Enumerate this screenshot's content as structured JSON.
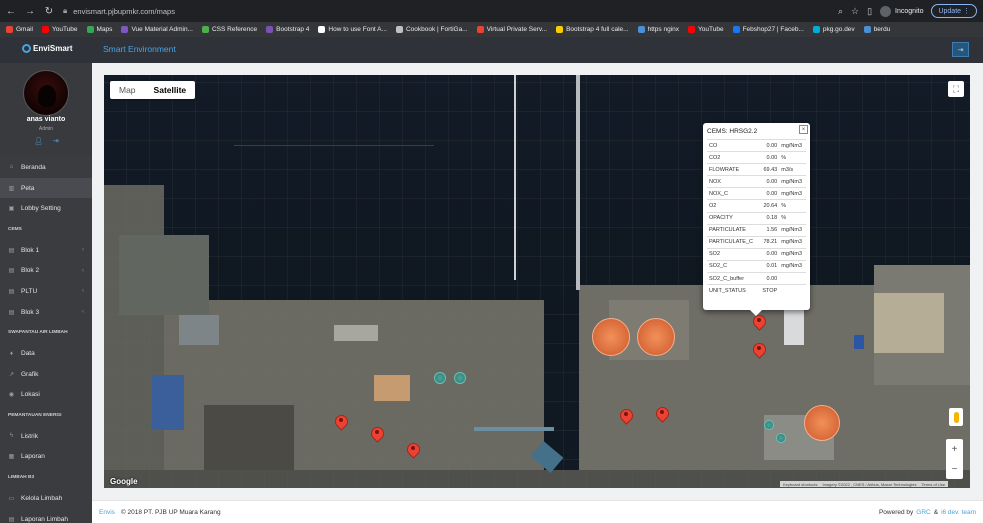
{
  "browser": {
    "url": "envismart.pjbupmkr.com/maps",
    "incognito_label": "Incognito",
    "update_label": "Update",
    "bookmarks": [
      {
        "label": "Gmail",
        "color": "#ea4335"
      },
      {
        "label": "YouTube",
        "color": "#ff0000"
      },
      {
        "label": "Maps",
        "color": "#34a853"
      },
      {
        "label": "Vue Material Admin...",
        "color": "#7e57c2"
      },
      {
        "label": "CSS Reference",
        "color": "#4caf50"
      },
      {
        "label": "Bootstrap 4",
        "color": "#7952b3"
      },
      {
        "label": "How to use Font A...",
        "color": "#ffffff"
      },
      {
        "label": "Cookbook | FortiGa...",
        "color": "#c0c0c0"
      },
      {
        "label": "Virtual Private Serv...",
        "color": "#ea4335"
      },
      {
        "label": "Bootstrap 4 full cale...",
        "color": "#ffcc00"
      },
      {
        "label": "https nginx",
        "color": "#4a90d9"
      },
      {
        "label": "YouTube",
        "color": "#ff0000"
      },
      {
        "label": "Febshop27 | Faceb...",
        "color": "#1877f2"
      },
      {
        "label": "pkg.go.dev",
        "color": "#00add8"
      },
      {
        "label": "berdu",
        "color": "#4a90d9"
      }
    ]
  },
  "app": {
    "logo_text": "EnviSmart",
    "title": "Smart Environment",
    "accent": "#4aa3df"
  },
  "user": {
    "name": "anas vianto",
    "role": "Admin"
  },
  "sidebar": {
    "items": [
      {
        "type": "item",
        "label": "Beranda",
        "icon": "home-icon",
        "glyph": "⌂",
        "arrow": ""
      },
      {
        "type": "item",
        "label": "Peta",
        "icon": "map-icon",
        "glyph": "▥",
        "arrow": "",
        "active": true
      },
      {
        "type": "item",
        "label": "Lobby Setting",
        "icon": "image-icon",
        "glyph": "▣",
        "arrow": ""
      },
      {
        "type": "section",
        "label": "CEMS"
      },
      {
        "type": "item",
        "label": "Blok 1",
        "icon": "file-icon",
        "glyph": "▤",
        "arrow": "‹"
      },
      {
        "type": "item",
        "label": "Blok 2",
        "icon": "file-icon",
        "glyph": "▤",
        "arrow": "‹"
      },
      {
        "type": "item",
        "label": "PLTU",
        "icon": "file-icon",
        "glyph": "▤",
        "arrow": "‹"
      },
      {
        "type": "item",
        "label": "Blok 3",
        "icon": "file-icon",
        "glyph": "▤",
        "arrow": "‹"
      },
      {
        "type": "section",
        "label": "SWAPANTAU AIR LIMBAH"
      },
      {
        "type": "item",
        "label": "Data",
        "icon": "droplet-icon",
        "glyph": "♦",
        "arrow": ""
      },
      {
        "type": "item",
        "label": "Grafik",
        "icon": "chart-icon",
        "glyph": "↗",
        "arrow": ""
      },
      {
        "type": "item",
        "label": "Lokasi",
        "icon": "location-icon",
        "glyph": "◉",
        "arrow": ""
      },
      {
        "type": "section",
        "label": "PEMANTAUAN ENERGI"
      },
      {
        "type": "item",
        "label": "Listrik",
        "icon": "bolt-icon",
        "glyph": "ϟ",
        "arrow": ""
      },
      {
        "type": "item",
        "label": "Laporan",
        "icon": "report-icon",
        "glyph": "▦",
        "arrow": ""
      },
      {
        "type": "section",
        "label": "LIMBAH B3"
      },
      {
        "type": "item",
        "label": "Kelola Limbah",
        "icon": "monitor-icon",
        "glyph": "▭",
        "arrow": ""
      },
      {
        "type": "item",
        "label": "Laporan Limbah",
        "icon": "report-icon",
        "glyph": "▤",
        "arrow": ""
      }
    ]
  },
  "map": {
    "type_map": "Map",
    "type_satellite": "Satellite",
    "selected_type": "Satellite",
    "google_label": "Google",
    "attribution": [
      "Keyboard shortcuts",
      "Imagery ©2022 , CNES / Airbus, Maxar Technologies",
      "Terms of Use"
    ]
  },
  "infowindow": {
    "title": "CEMS: HRSG2.2",
    "rows": [
      {
        "param": "CO",
        "value": "0.00",
        "unit": "mg/Nm3"
      },
      {
        "param": "CO2",
        "value": "0.00",
        "unit": "%"
      },
      {
        "param": "FLOWRATE",
        "value": "69.43",
        "unit": "m3/s"
      },
      {
        "param": "NOX",
        "value": "0.00",
        "unit": "mg/Nm3"
      },
      {
        "param": "NOX_C",
        "value": "0.00",
        "unit": "mg/Nm3"
      },
      {
        "param": "O2",
        "value": "20.64",
        "unit": "%"
      },
      {
        "param": "OPACITY",
        "value": "0.18",
        "unit": "%"
      },
      {
        "param": "PARTICULATE",
        "value": "1.56",
        "unit": "mg/Nm3"
      },
      {
        "param": "PARTICULATE_C",
        "value": "78.21",
        "unit": "mg/Nm3"
      },
      {
        "param": "SO2",
        "value": "0.00",
        "unit": "mg/Nm3"
      },
      {
        "param": "SO2_C",
        "value": "0.01",
        "unit": "mg/Nm3"
      },
      {
        "param": "SO2_C_buffer",
        "value": "0.00",
        "unit": ""
      },
      {
        "param": "UNIT_STATUS",
        "value": "STOP",
        "unit": ""
      }
    ]
  },
  "footer": {
    "brand": "Envis",
    "copyright": "© 2018 PT. PJB UP Muara Karang",
    "powered_by": "Powered by",
    "link1": "GRC",
    "amp": "&",
    "link2": "i6 dev. team"
  }
}
